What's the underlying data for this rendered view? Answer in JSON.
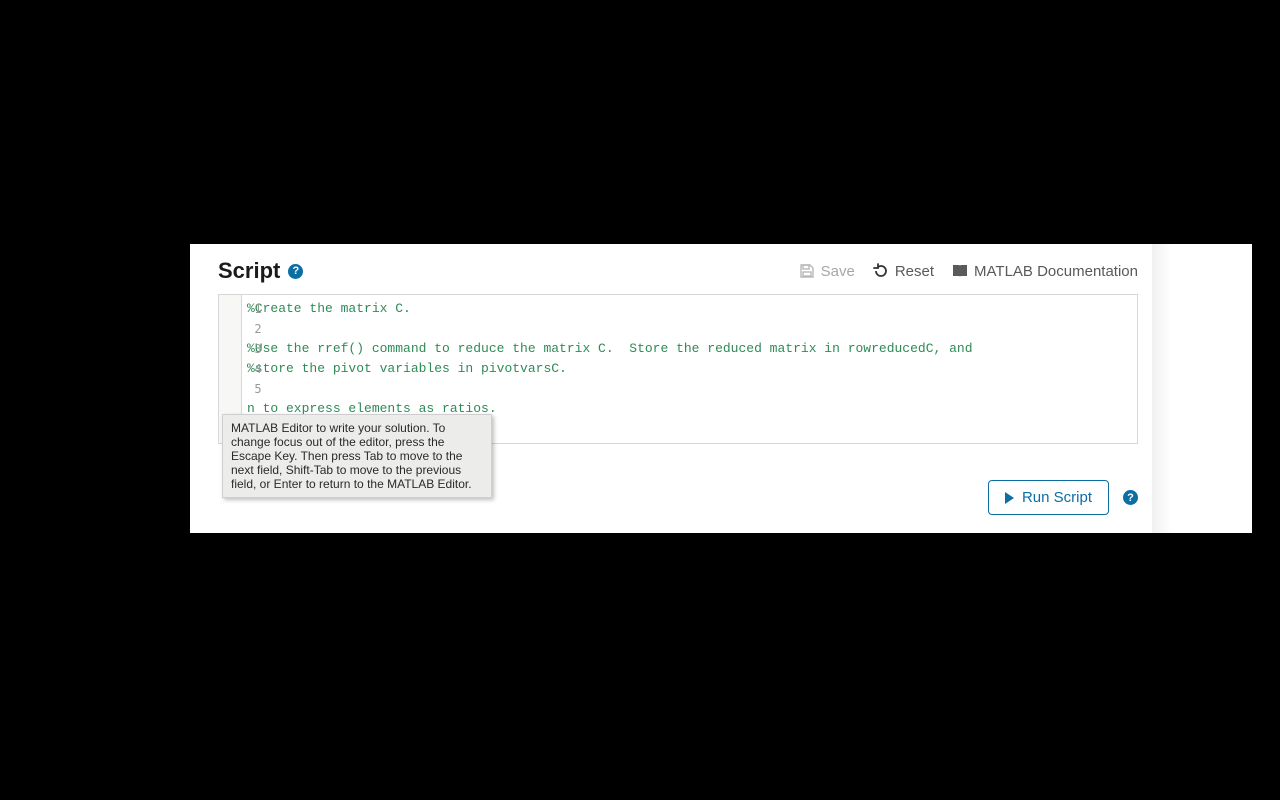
{
  "header": {
    "title": "Script",
    "help_glyph": "?"
  },
  "toolbar": {
    "save_label": "Save",
    "reset_label": "Reset",
    "docs_label": "MATLAB Documentation"
  },
  "editor": {
    "lines": [
      "%Create the matrix C.",
      "",
      "%Use the rref() command to reduce the matrix C.  Store the reduced matrix in rowreducedC, and",
      "%store the pivot variables in pivotvarsC.",
      "",
      "n to express elements as ratios."
    ],
    "line_numbers": [
      "1",
      "2",
      "3",
      "4",
      "5"
    ]
  },
  "tooltip": {
    "text": "MATLAB Editor to write your solution. To change focus out of the editor, press the Escape Key. Then press Tab to move to the next field, Shift-Tab to move to the previous field, or Enter to return to the MATLAB Editor."
  },
  "footer": {
    "run_label": "Run Script",
    "help_glyph": "?"
  }
}
